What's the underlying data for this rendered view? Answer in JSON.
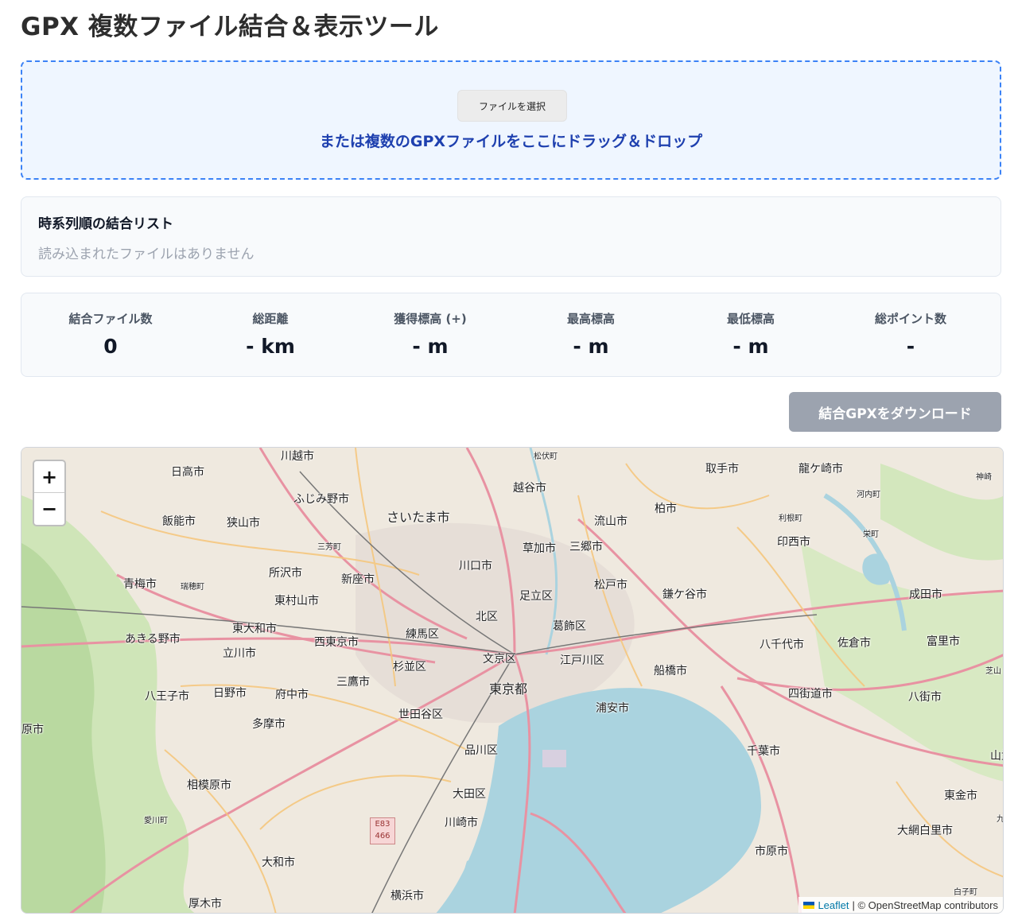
{
  "title": "GPX 複数ファイル結合＆表示ツール",
  "dropzone": {
    "file_button": "ファイルを選択",
    "text": "または複数のGPXファイルをここにドラッグ＆ドロップ"
  },
  "file_list": {
    "title": "時系列順の結合リスト",
    "empty": "読み込まれたファイルはありません"
  },
  "stats": [
    {
      "label": "結合ファイル数",
      "value": "0"
    },
    {
      "label": "総距離",
      "value": "- km"
    },
    {
      "label": "獲得標高 (+)",
      "value": "- m"
    },
    {
      "label": "最高標高",
      "value": "- m"
    },
    {
      "label": "最低標高",
      "value": "- m"
    },
    {
      "label": "総ポイント数",
      "value": "-"
    }
  ],
  "download_button": "結合GPXをダウンロード",
  "map": {
    "zoom_in": "+",
    "zoom_out": "−",
    "attribution_link": "Leaflet",
    "attribution_text": "| © OpenStreetMap contributors",
    "shield_top": "E83",
    "shield_bottom": "466",
    "places": [
      "川越市",
      "松伏町",
      "日高市",
      "越谷市",
      "取手市",
      "龍ケ崎市",
      "神崎",
      "ふじみ野市",
      "さいたま市",
      "柏市",
      "河内町",
      "飯能市",
      "狭山市",
      "流山市",
      "利根町",
      "栄町",
      "三芳町",
      "草加市",
      "三郷市",
      "印西市",
      "所沢市",
      "新座市",
      "川口市",
      "青梅市",
      "瑞穂町",
      "東村山市",
      "足立区",
      "松戸市",
      "鎌ケ谷市",
      "成田市",
      "北区",
      "葛飾区",
      "東大和市",
      "あきる野市",
      "練馬区",
      "西東京市",
      "八千代市",
      "佐倉市",
      "富里市",
      "立川市",
      "文京区",
      "江戸川区",
      "杉並区",
      "船橋市",
      "芝山",
      "三鷹市",
      "東京都",
      "八王子市",
      "日野市",
      "府中市",
      "四街道市",
      "八街市",
      "浦安市",
      "世田谷区",
      "多摩市",
      "原市",
      "品川区",
      "千葉市",
      "山武",
      "相模原市",
      "大田区",
      "東金市",
      "愛川町",
      "川崎市",
      "九",
      "大網白里市",
      "大和市",
      "市原市",
      "白子町",
      "厚木市",
      "横浜市"
    ]
  }
}
